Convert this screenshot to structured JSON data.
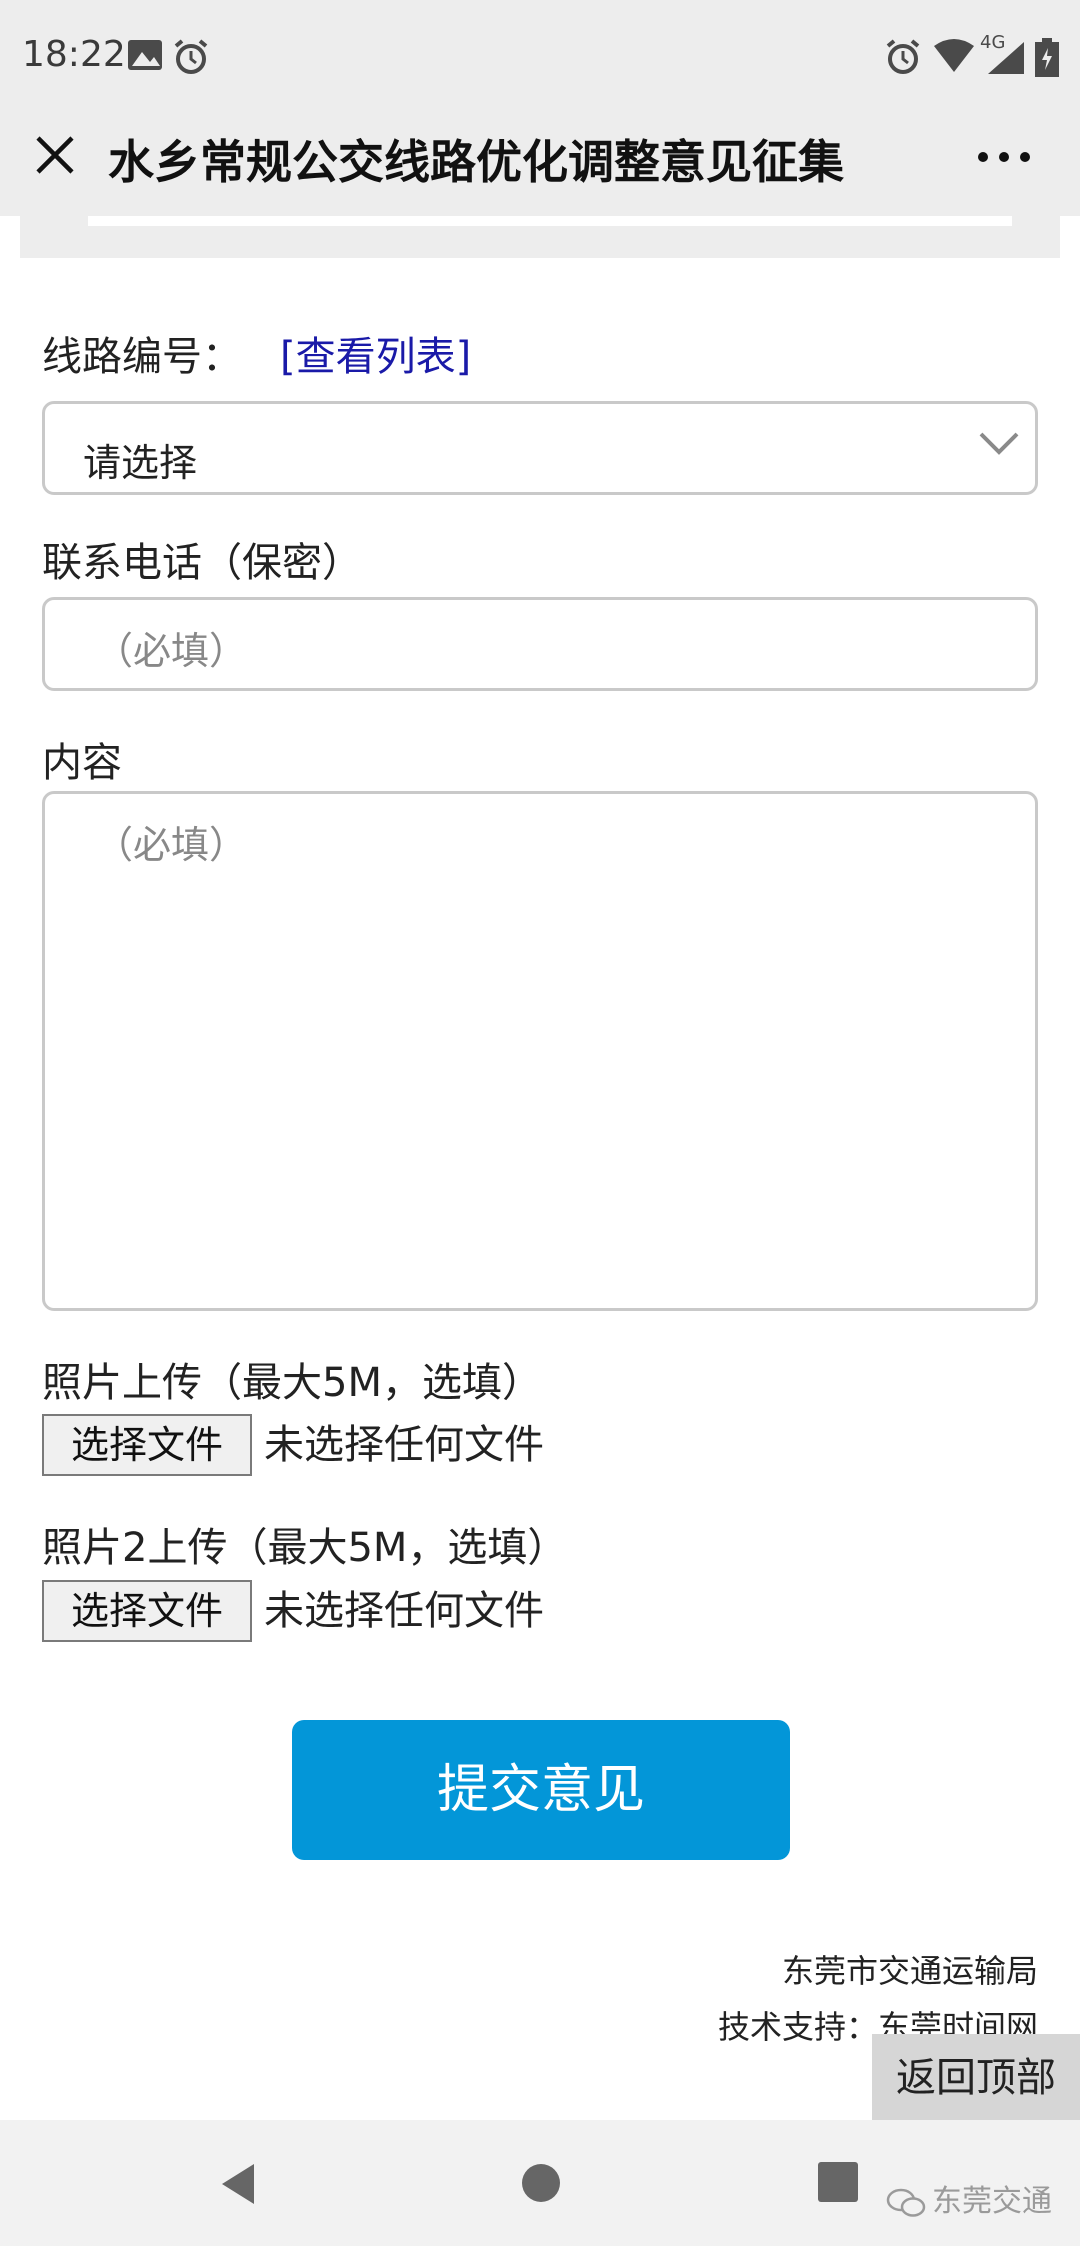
{
  "status_bar": {
    "time": "18:22",
    "network": "4G",
    "icons": [
      "image-icon",
      "alarm-icon",
      "alarm-icon",
      "wifi-icon",
      "signal-icon",
      "battery-icon"
    ]
  },
  "header": {
    "title": "水乡常规公交线路优化调整意见征集",
    "close_icon": "close-icon",
    "more_icon": "more-icon"
  },
  "form": {
    "route_label": "线路编号：",
    "route_link": "[查看列表]",
    "route_select_value": "请选择",
    "phone_label": "联系电话（保密）",
    "phone_placeholder": "（必填）",
    "content_label": "内容",
    "content_placeholder": "（必填）",
    "photo1_label": "照片上传（最大5M，选填）",
    "photo1_button": "选择文件",
    "photo1_status": "未选择任何文件",
    "photo2_label": "照片2上传（最大5M，选填）",
    "photo2_button": "选择文件",
    "photo2_status": "未选择任何文件",
    "submit_label": "提交意见"
  },
  "footer": {
    "org": "东莞市交通运输局",
    "support": "技术支持：东莞时间网",
    "back_to_top": "返回顶部"
  },
  "nav_bar": {
    "watermark": "东莞交通"
  },
  "colors": {
    "submit_bg": "#0396d8",
    "link": "#1a1aa8",
    "chrome_bg": "#ededed"
  }
}
